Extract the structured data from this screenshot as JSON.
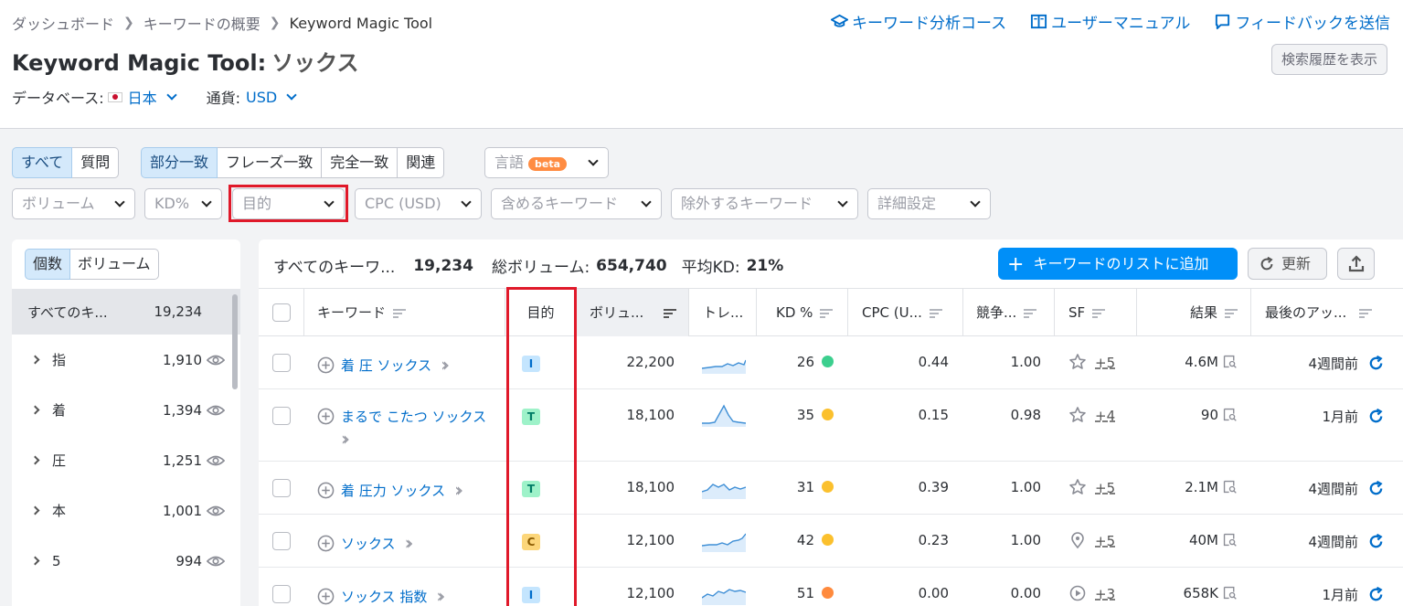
{
  "breadcrumb": [
    "ダッシュボード",
    "キーワードの概要",
    "Keyword Magic Tool"
  ],
  "top_links": [
    {
      "label": "キーワード分析コース",
      "icon": "graduation-cap-icon"
    },
    {
      "label": "ユーザーマニュアル",
      "icon": "book-icon"
    },
    {
      "label": "フィードバックを送信",
      "icon": "speech-bubble-icon"
    }
  ],
  "title": {
    "tool": "Keyword Magic Tool:",
    "keyword": "ソックス"
  },
  "history_button": "検索履歴を表示",
  "database": {
    "label": "データベース:",
    "value": "日本"
  },
  "currency": {
    "label": "通貨:",
    "value": "USD"
  },
  "match_toggle": {
    "all": "すべて",
    "questions": "質問"
  },
  "match_types": [
    "部分一致",
    "フレーズ一致",
    "完全一致",
    "関連"
  ],
  "language": {
    "label": "言語",
    "badge": "beta"
  },
  "filters": [
    "ボリューム",
    "KD%",
    "目的",
    "CPC (USD)",
    "含めるキーワード",
    "除外するキーワード",
    "詳細設定"
  ],
  "sidebar": {
    "toggle": [
      "個数",
      "ボリューム"
    ],
    "all": {
      "label": "すべてのキ...",
      "count": "19,234"
    },
    "groups": [
      {
        "label": "指",
        "count": "1,910"
      },
      {
        "label": "着",
        "count": "1,394"
      },
      {
        "label": "圧",
        "count": "1,251"
      },
      {
        "label": "本",
        "count": "1,001"
      },
      {
        "label": "5",
        "count": "994"
      }
    ]
  },
  "summary": {
    "all_label": "すべてのキーワ...",
    "all_count": "19,234",
    "volume_label": "総ボリューム:",
    "volume": "654,740",
    "kd_label": "平均KD:",
    "kd": "21%"
  },
  "actions": {
    "add": "キーワードのリストに追加",
    "update": "更新"
  },
  "columns": [
    "キーワード",
    "目的",
    "ボリュ...",
    "トレ...",
    "KD %",
    "CPC (U...",
    "競争...",
    "SF",
    "結果",
    "最後のアッ..."
  ],
  "rows": [
    {
      "keyword": "着 圧 ソックス",
      "intent": "I",
      "volume": "22,200",
      "kd": "26",
      "kd_color": "#3ccf8e",
      "cpc": "0.44",
      "comp": "1.00",
      "sf_icon": "star-icon",
      "sf": "+5",
      "results": "4.6M",
      "updated": "4週間前"
    },
    {
      "keyword": "まるで こたつ ソックス",
      "intent": "T",
      "volume": "18,100",
      "kd": "35",
      "kd_color": "#fbc02d",
      "cpc": "0.15",
      "comp": "0.98",
      "sf_icon": "star-icon",
      "sf": "+4",
      "results": "90",
      "updated": "1月前"
    },
    {
      "keyword": "着 圧力 ソックス",
      "intent": "T",
      "volume": "18,100",
      "kd": "31",
      "kd_color": "#fbc02d",
      "cpc": "0.39",
      "comp": "1.00",
      "sf_icon": "star-icon",
      "sf": "+5",
      "results": "2.1M",
      "updated": "4週間前"
    },
    {
      "keyword": "ソックス",
      "intent": "C",
      "volume": "12,100",
      "kd": "42",
      "kd_color": "#fbc02d",
      "cpc": "0.23",
      "comp": "1.00",
      "sf_icon": "location-pin-icon",
      "sf": "+5",
      "results": "40M",
      "updated": "4週間前"
    },
    {
      "keyword": "ソックス 指数",
      "intent": "I",
      "volume": "12,100",
      "kd": "51",
      "kd_color": "#ff8a3d",
      "cpc": "0.00",
      "comp": "0.00",
      "sf_icon": "play-circle-icon",
      "sf": "+3",
      "results": "658K",
      "updated": "1月前"
    }
  ],
  "intent_colors": {
    "I": {
      "bg": "#c4e5fe",
      "fg": "#006dca"
    },
    "T": {
      "bg": "#9ef2c9",
      "fg": "#007c65"
    },
    "C": {
      "bg": "#fcd67a",
      "fg": "#8a5a00"
    }
  },
  "highlight_color": "#e0192a",
  "accent_color": "#008ff8"
}
